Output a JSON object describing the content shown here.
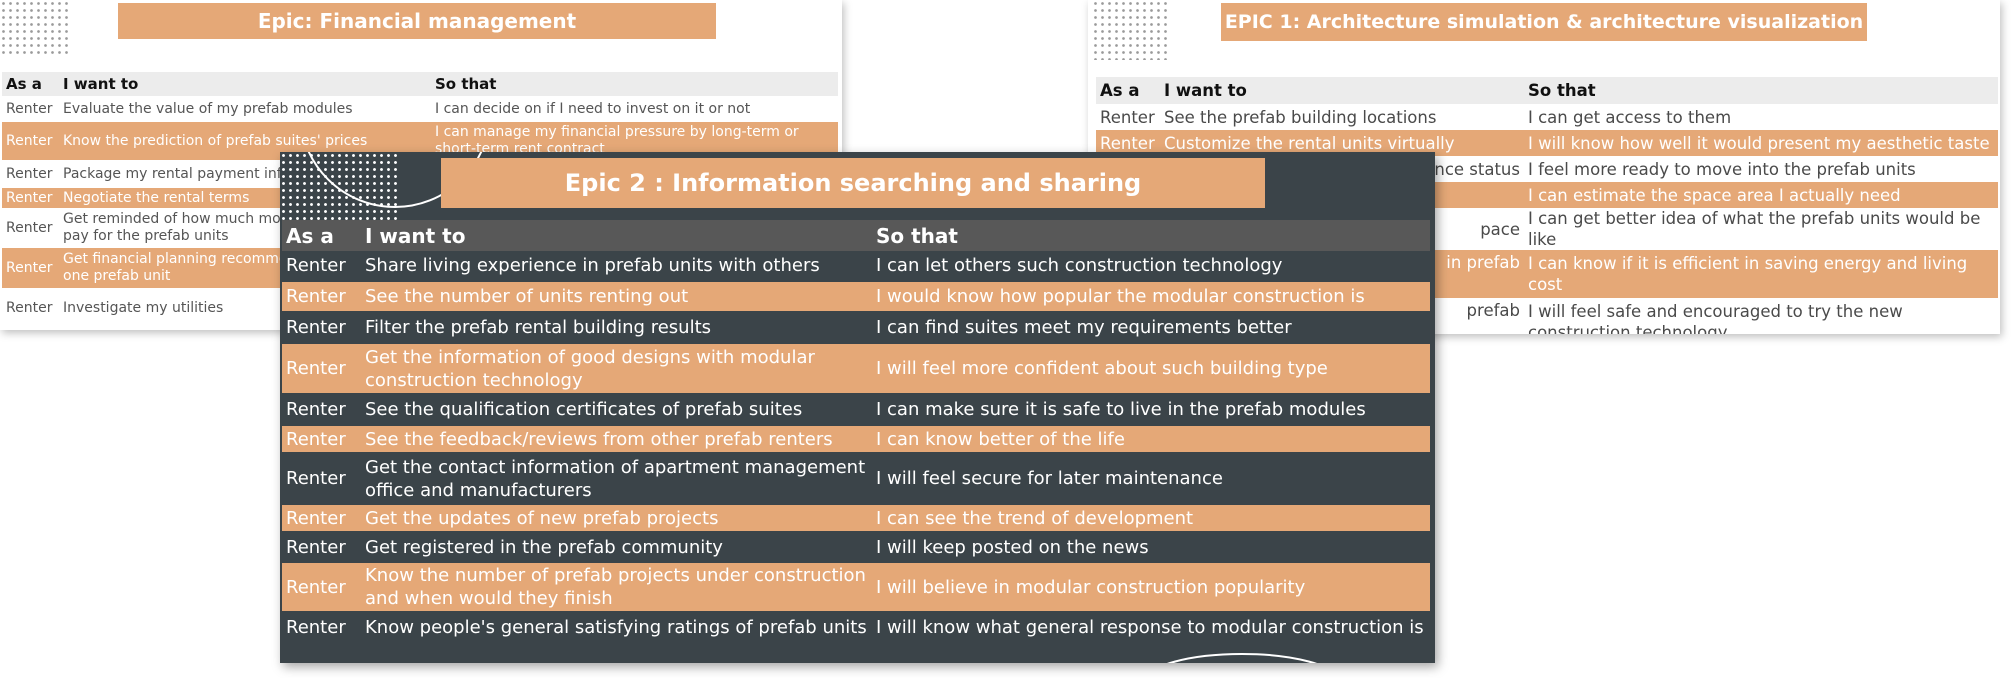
{
  "financial_slide": {
    "title": "Epic:  Financial management",
    "headers": [
      "As a",
      "I want to",
      "So that"
    ],
    "rows": [
      {
        "role": "Renter",
        "want": "Evaluate the value of my prefab modules",
        "so": "I can decide on if I need to invest on it or not"
      },
      {
        "role": "Renter",
        "want": "Know the prediction of prefab suites' prices",
        "so": "I can manage my financial pressure by long-term or short-term rent contract"
      },
      {
        "role": "Renter",
        "want": "Package my rental payment info",
        "so": ""
      },
      {
        "role": "Renter",
        "want": "Negotiate the rental terms",
        "so": ""
      },
      {
        "role": "Renter",
        "want": "Get reminded of how much more money I need to pay for the prefab units",
        "so": ""
      },
      {
        "role": "Renter",
        "want": "Get financial planning recommendations to lease one prefab unit",
        "so": ""
      },
      {
        "role": "Renter",
        "want": "Investigate my utilities",
        "so": ""
      }
    ]
  },
  "architecture_slide": {
    "title": "EPIC 1:  Architecture simulation & architecture visualization",
    "headers": [
      "As a",
      "I want to",
      "So that"
    ],
    "rows": [
      {
        "role": "Renter",
        "want": "See the prefab building locations",
        "so": "I can get access to them"
      },
      {
        "role": "Renter",
        "want": "Customize the rental units virtually",
        "so": "I will know how well it would present my aesthetic taste"
      },
      {
        "role": "",
        "want": "nce status",
        "so": "I feel more ready to move into the prefab units"
      },
      {
        "role": "",
        "want": "",
        "so": "I can estimate the space area I actually need"
      },
      {
        "role": "",
        "want": "pace",
        "so": "I can get better idea of what the prefab units would be like"
      },
      {
        "role": "",
        "want": "in prefab",
        "so": "I can know if it is efficient in saving energy and living cost"
      },
      {
        "role": "",
        "want": "prefab",
        "so": "I will feel safe and encouraged to try the new construction technology"
      }
    ]
  },
  "info_slide": {
    "title": "Epic 2 :  Information searching and sharing",
    "headers": [
      "As a",
      "I want to",
      "So that"
    ],
    "rows": [
      {
        "role": "Renter",
        "want": "Share living experience in prefab units with others",
        "so": "I can let others such construction technology"
      },
      {
        "role": "Renter",
        "want": "See the number of units renting out",
        "so": "I would know how popular the modular construction is"
      },
      {
        "role": "Renter",
        "want": "Filter the prefab rental building results",
        "so": "I can find suites meet my requirements better"
      },
      {
        "role": "Renter",
        "want": "Get the information of good designs with modular construction technology",
        "so": "I will feel more confident about such building type"
      },
      {
        "role": "Renter",
        "want": "See the qualification certificates of prefab suites",
        "so": "I can make sure it is safe to live in the prefab modules"
      },
      {
        "role": "Renter",
        "want": "See the feedback/reviews from other prefab renters",
        "so": "I can know better of the life"
      },
      {
        "role": "Renter",
        "want": "Get the contact information of apartment management office and manufacturers",
        "so": "I will feel secure for later maintenance"
      },
      {
        "role": "Renter",
        "want": "Get the updates of new prefab projects",
        "so": "I can see the trend of development"
      },
      {
        "role": "Renter",
        "want": "Get registered in the prefab community",
        "so": "I will keep posted on the news"
      },
      {
        "role": "Renter",
        "want": "Know the number of prefab projects under construction and when would they finish",
        "so": "I will believe in modular construction popularity"
      },
      {
        "role": "Renter",
        "want": "Know people's general satisfying ratings of prefab units",
        "so": "I will know what general response to modular construction is"
      }
    ]
  },
  "colors": {
    "accent": "#E5A877",
    "dark": "#3B4449",
    "header_gray": "#ececec"
  }
}
